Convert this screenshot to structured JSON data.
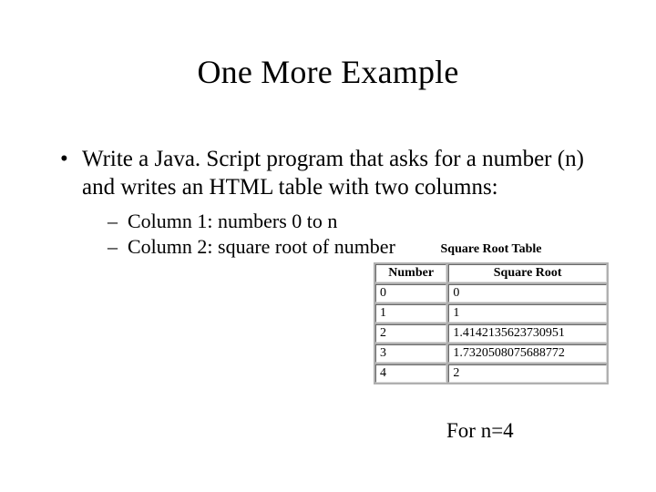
{
  "title": "One More Example",
  "bullet": "Write a Java. Script program that asks for a number (n) and writes an HTML table with two columns:",
  "sub": [
    "Column 1: numbers 0 to n",
    "Column 2: square root of number"
  ],
  "figure": {
    "title": "Square Root Table",
    "headers": [
      "Number",
      "Square Root"
    ],
    "rows": [
      [
        "0",
        "0"
      ],
      [
        "1",
        "1"
      ],
      [
        "2",
        "1.4142135623730951"
      ],
      [
        "3",
        "1.7320508075688772"
      ],
      [
        "4",
        "2"
      ]
    ]
  },
  "caption": "For n=4"
}
